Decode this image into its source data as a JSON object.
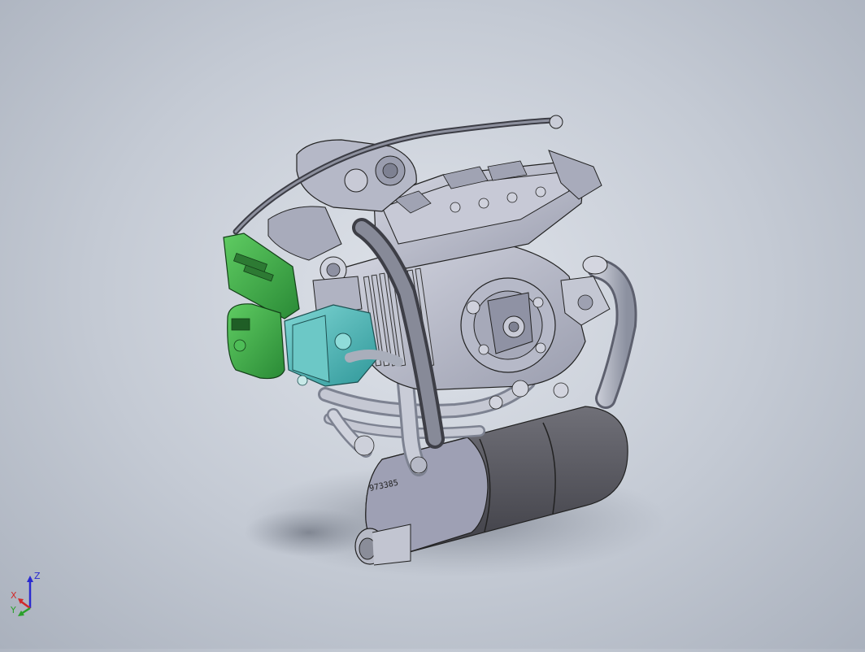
{
  "viewport": {
    "background_top": "#dfe3ea",
    "background_bottom": "#aab1bd"
  },
  "model": {
    "part_marking": "973385",
    "colors": {
      "body": "#b9bccb",
      "body_dark": "#8e91a3",
      "muffler": "#5a5a60",
      "ecu_green": "#3fa84a",
      "intake_teal": "#4fb7b8",
      "pipe": "#9aa0ae"
    }
  },
  "triad": {
    "z_label": "Z",
    "x_label": "X",
    "y_label": "Y",
    "z_color": "#2a2ad0",
    "x_color": "#d02a2a",
    "y_color": "#2aa02a"
  }
}
